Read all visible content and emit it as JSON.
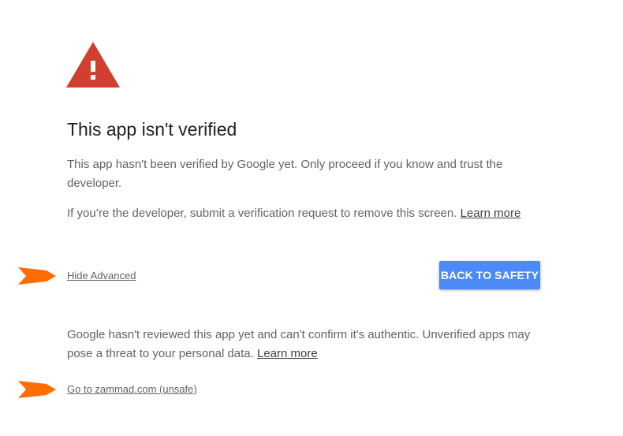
{
  "title": "This app isn't verified",
  "paragraph1": "This app hasn't been verified by Google yet. Only proceed if you know and trust the developer.",
  "paragraph2": {
    "text": "If you’re the developer, submit a verification request to remove this screen. ",
    "link": "Learn more"
  },
  "hide_advanced_label": "Hide Advanced",
  "back_to_safety_label": "BACK TO SAFETY",
  "paragraph3": {
    "text": "Google hasn't reviewed this app yet and can't confirm it's authentic. Unverified apps may pose a threat to your personal data. ",
    "link": "Learn more"
  },
  "goto_link_label": "Go to zammad.com (unsafe)",
  "icons": {
    "warning": "warning-triangle-icon",
    "annotation_arrow": "orange-arrow-icon"
  },
  "colors": {
    "warning_red": "#d23f31",
    "button_blue": "#4c8bf5",
    "arrow_orange": "#ff6d00",
    "title": "#202124",
    "body_text": "#5f6368"
  }
}
